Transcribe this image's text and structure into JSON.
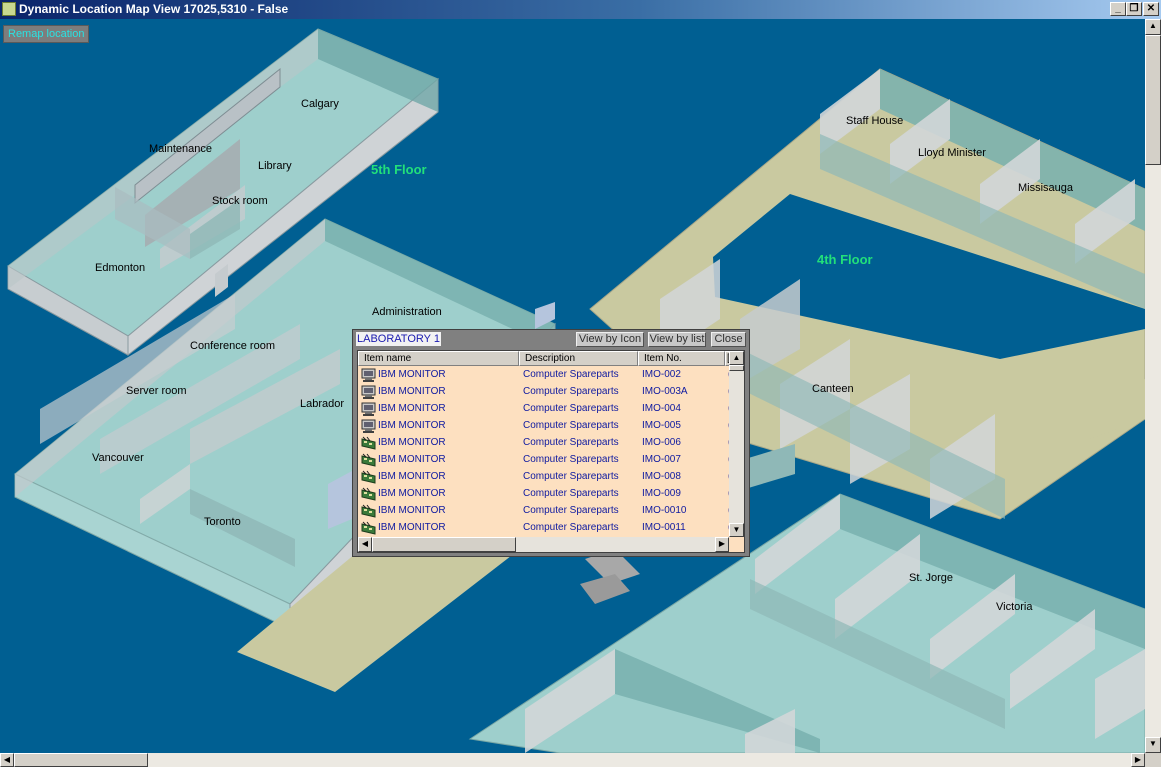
{
  "window": {
    "title": "Dynamic Location Map View 17025,5310 - False",
    "minimize_glyph": "_",
    "restore_glyph": "❐",
    "close_glyph": "✕"
  },
  "toolbar": {
    "remap_label": "Remap location"
  },
  "map": {
    "floors": [
      "5th Floor",
      "4th Floor"
    ],
    "rooms": [
      "Calgary",
      "Maintenance",
      "Library",
      "Stock room",
      "Edmonton",
      "Administration",
      "Conference room",
      "Server room",
      "Labrador",
      "Vancouver",
      "Toronto",
      "Staff House",
      "Lloyd Minister",
      "Missisauga",
      "Canteen",
      "St. Jorge",
      "Victoria"
    ]
  },
  "panel": {
    "title": "LABORATORY 1",
    "view_by_icon_label": "View by Icon",
    "view_by_list_label": "View by list",
    "close_label": "Close",
    "columns": [
      "Item name",
      "Description",
      "Item No.",
      "["
    ],
    "rows": [
      {
        "icon": "monitor-icon",
        "name": "IBM MONITOR",
        "description": "Computer Spareparts",
        "item_no": "IMO-002",
        "extra": "("
      },
      {
        "icon": "monitor-icon",
        "name": "IBM MONITOR",
        "description": "Computer Spareparts",
        "item_no": "IMO-003A",
        "extra": "("
      },
      {
        "icon": "monitor-icon",
        "name": "IBM MONITOR",
        "description": "Computer Spareparts",
        "item_no": "IMO-004",
        "extra": "("
      },
      {
        "icon": "monitor-icon",
        "name": "IBM MONITOR",
        "description": "Computer Spareparts",
        "item_no": "IMO-005",
        "extra": "("
      },
      {
        "icon": "circuit-board-icon",
        "name": "IBM MONITOR",
        "description": "Computer Spareparts",
        "item_no": "IMO-006",
        "extra": "("
      },
      {
        "icon": "circuit-board-icon",
        "name": "IBM MONITOR",
        "description": "Computer Spareparts",
        "item_no": "IMO-007",
        "extra": "("
      },
      {
        "icon": "circuit-board-icon",
        "name": "IBM MONITOR",
        "description": "Computer Spareparts",
        "item_no": "IMO-008",
        "extra": "("
      },
      {
        "icon": "circuit-board-icon",
        "name": "IBM MONITOR",
        "description": "Computer Spareparts",
        "item_no": "IMO-009",
        "extra": "("
      },
      {
        "icon": "circuit-board-icon",
        "name": "IBM MONITOR",
        "description": "Computer Spareparts",
        "item_no": "IMO-0010",
        "extra": "("
      },
      {
        "icon": "circuit-board-icon",
        "name": "IBM MONITOR",
        "description": "Computer Spareparts",
        "item_no": "IMO-0011",
        "extra": "("
      }
    ]
  },
  "colors": {
    "map_background": "#005f92",
    "floor_label": "#22e07a",
    "room_floor": "#9ecfcc",
    "corridor": "#c9c9a0",
    "list_background": "#fde0c0",
    "list_text": "#0f1aa0"
  }
}
